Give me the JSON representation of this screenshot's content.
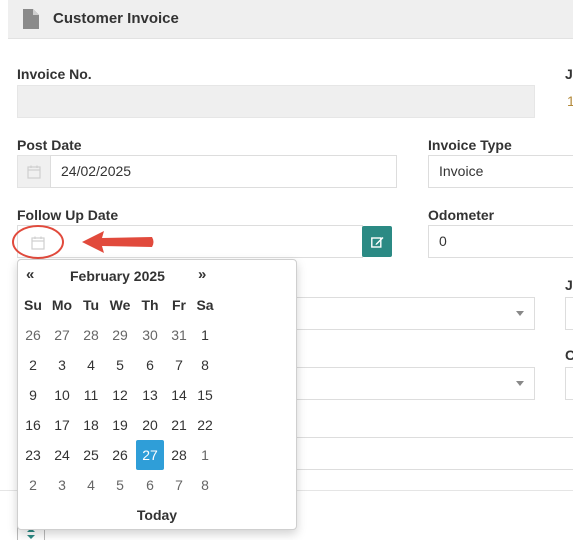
{
  "header": {
    "title": "Customer Invoice",
    "icon": "document-icon"
  },
  "fields": {
    "invoice_no": {
      "label": "Invoice No.",
      "value": ""
    },
    "post_date": {
      "label": "Post Date",
      "value": "24/02/2025"
    },
    "invoice_type": {
      "label": "Invoice Type",
      "value": "Invoice"
    },
    "follow_up_date": {
      "label": "Follow Up Date",
      "value": ""
    },
    "odometer": {
      "label": "Odometer",
      "value": "0"
    },
    "right_cut_label_1": "J",
    "right_cut_value_1": "1",
    "right_cut_label_2": "J",
    "right_cut_label_3": "C"
  },
  "annotation": {
    "circle_color": "#e14a3c",
    "arrow_color": "#e14a3c"
  },
  "datepicker": {
    "prev": "«",
    "next": "»",
    "month_label": "February 2025",
    "weekdays": [
      "Su",
      "Mo",
      "Tu",
      "We",
      "Th",
      "Fr",
      "Sa"
    ],
    "weeks": [
      [
        "26",
        "27",
        "28",
        "29",
        "30",
        "31",
        "1"
      ],
      [
        "2",
        "3",
        "4",
        "5",
        "6",
        "7",
        "8"
      ],
      [
        "9",
        "10",
        "11",
        "12",
        "13",
        "14",
        "15"
      ],
      [
        "16",
        "17",
        "18",
        "19",
        "20",
        "21",
        "22"
      ],
      [
        "23",
        "24",
        "25",
        "26",
        "27",
        "28",
        "1"
      ],
      [
        "2",
        "3",
        "4",
        "5",
        "6",
        "7",
        "8"
      ]
    ],
    "selected": "27",
    "selected_color": "#2f9ed8",
    "today_label": "Today"
  },
  "colors": {
    "edit_button": "#2b8a84",
    "header_bg": "#efefef"
  }
}
